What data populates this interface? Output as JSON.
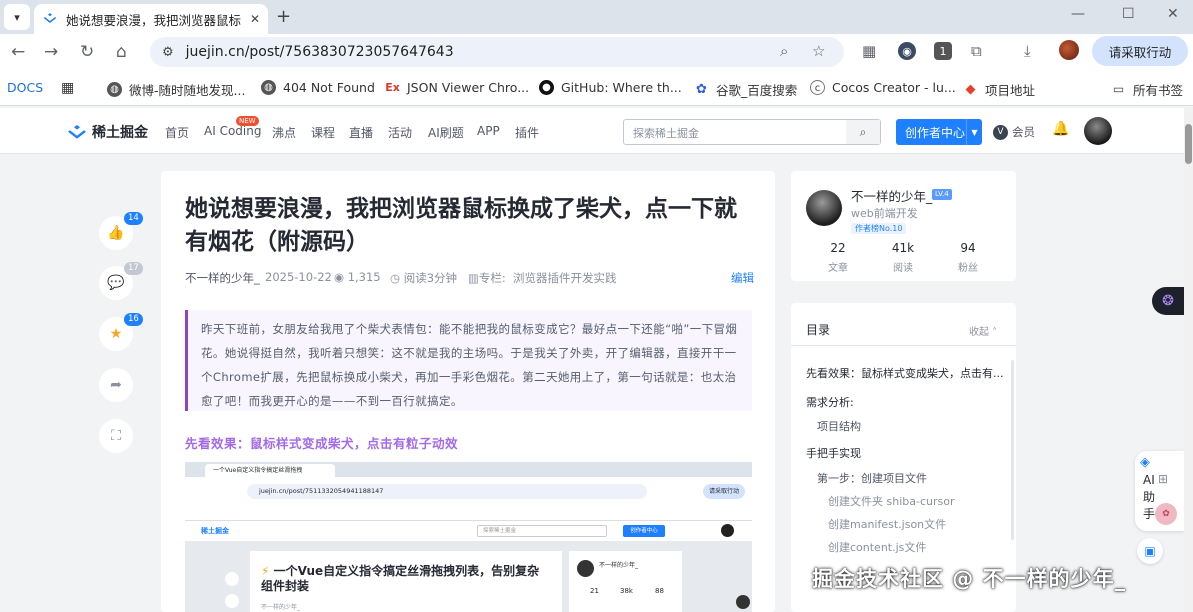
{
  "browser": {
    "tab_title": "她说想要浪漫，我把浏览器鼠标",
    "url": "juejin.cn/post/7563830723057647643",
    "request_label": "请采取行动",
    "ext_badge": "1"
  },
  "bookmarks": [
    "DOCS",
    "微博-随时随地发现...",
    "404 Not Found",
    "JSON Viewer Chro...",
    "GitHub: Where th...",
    "谷歌_百度搜索",
    "Cocos Creator - lu...",
    "项目地址",
    "所有书签"
  ],
  "header": {
    "logo": "稀土掘金",
    "nav": [
      "首页",
      "AI Coding",
      "沸点",
      "课程",
      "直播",
      "活动",
      "AI刷题",
      "APP",
      "插件"
    ],
    "new_badge": "NEW",
    "search_placeholder": "探索稀土掘金",
    "creator_label": "创作者中心",
    "vip_label": "会员"
  },
  "side_actions": {
    "like_count": "14",
    "comment_count": "17",
    "star_count": "16"
  },
  "article": {
    "title": "她说想要浪漫，我把浏览器鼠标换成了柴犬，点一下就有烟花（附源码）",
    "author": "不一样的少年_",
    "date": "2025-10-22",
    "views": "1,315",
    "read_time": "阅读3分钟",
    "column_prefix": "专栏:",
    "column": "浏览器插件开发实践",
    "edit": "编辑",
    "quote": "昨天下班前，女朋友给我甩了个柴犬表情包：能不能把我的鼠标变成它？最好点一下还能“啪”一下冒烟花。她说得挺自然，我听着只想笑：这不就是我的主场吗。于是我关了外卖，开了编辑器，直接开干一个Chrome扩展，先把鼠标换成小柴犬，再加一手彩色烟花。第二天她用上了，第一句话就是：也太治愈了吧！而我更开心的是——不到一百行就搞定。",
    "subheading": "先看效果：鼠标样式变成柴犬，点击有粒子动效"
  },
  "embedded": {
    "tab": "一个Vue自定义指令搞定丝滑拖拽",
    "url": "juejin.cn/post/7511332054941188147",
    "title": "一个Vue自定义指令搞定丝滑拖拽列表，告别复杂组件封装",
    "author": "不一样的少年_",
    "stats": [
      "21",
      "38k",
      "88"
    ]
  },
  "profile": {
    "name": "不一样的少年_",
    "level": "LV.4",
    "role": "web前端开发",
    "rank": "作者榜No.10",
    "stats": [
      {
        "value": "22",
        "label": "文章"
      },
      {
        "value": "41k",
        "label": "阅读"
      },
      {
        "value": "94",
        "label": "粉丝"
      }
    ]
  },
  "toc": {
    "title": "目录",
    "collapse": "收起",
    "items": [
      {
        "text": "先看效果：鼠标样式变成柴犬，点击有...",
        "level": 1
      },
      {
        "text": "需求分析:",
        "level": 1
      },
      {
        "text": "项目结构",
        "level": 2
      },
      {
        "text": "手把手实现",
        "level": 1
      },
      {
        "text": "第一步：创建项目文件",
        "level": 2
      },
      {
        "text": "创建文件夹 shiba-cursor",
        "level": 3
      },
      {
        "text": "创建manifest.json文件",
        "level": 3
      },
      {
        "text": "创建content.js文件",
        "level": 3
      }
    ]
  },
  "assistant": {
    "label": "AI助手"
  },
  "watermark": "掘金技术社区 @ 不一样的少年_"
}
